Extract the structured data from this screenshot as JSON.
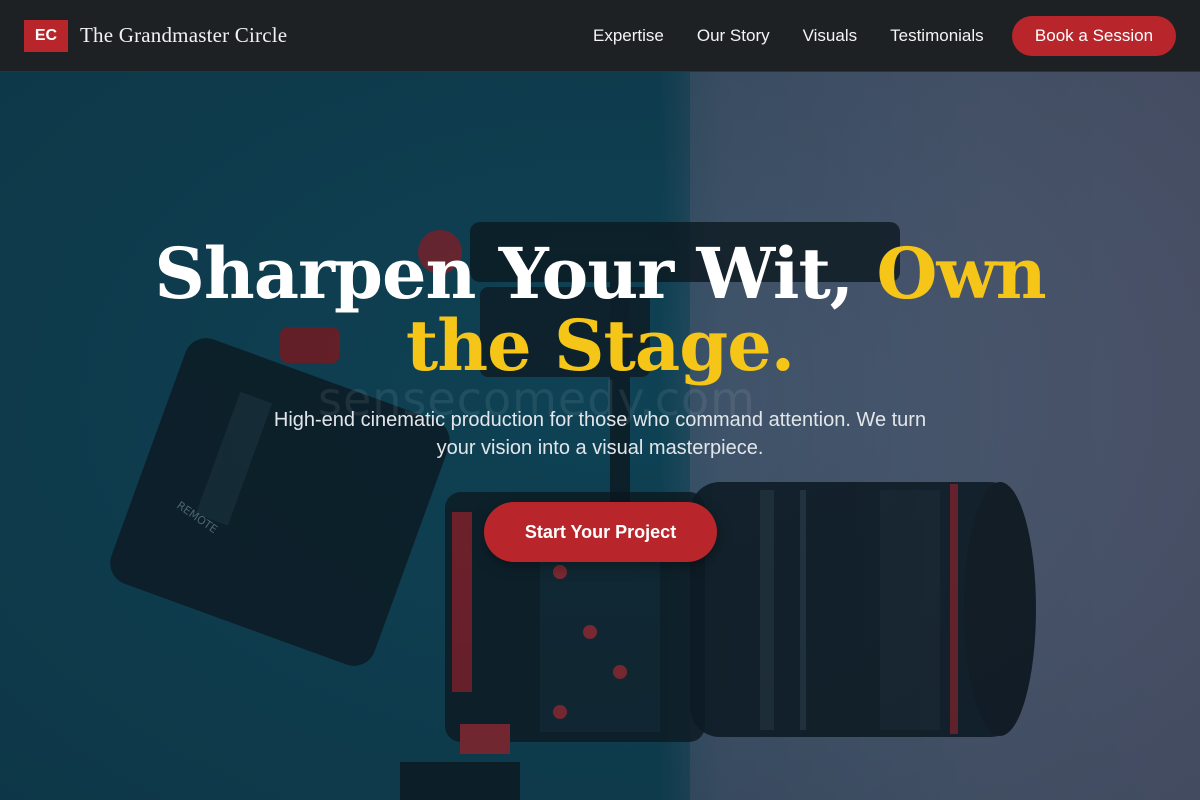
{
  "header": {
    "logo_text": "EC",
    "brand_name": "The Grandmaster Circle",
    "nav": [
      "Expertise",
      "Our Story",
      "Visuals",
      "Testimonials"
    ],
    "cta_label": "Book a Session"
  },
  "hero": {
    "headline_main": "Sharpen Your Wit, ",
    "headline_accent": "Own the Stage.",
    "subtitle": "High-end cinematic production for those who command attention. We turn your vision into a visual masterpiece.",
    "cta_label": "Start Your Project",
    "watermark": "sensecomedy.com",
    "background_image": "camera-rig-photo"
  },
  "colors": {
    "accent_red": "#b8262b",
    "accent_yellow": "#f5c518",
    "nav_bg": "#1d2124"
  }
}
